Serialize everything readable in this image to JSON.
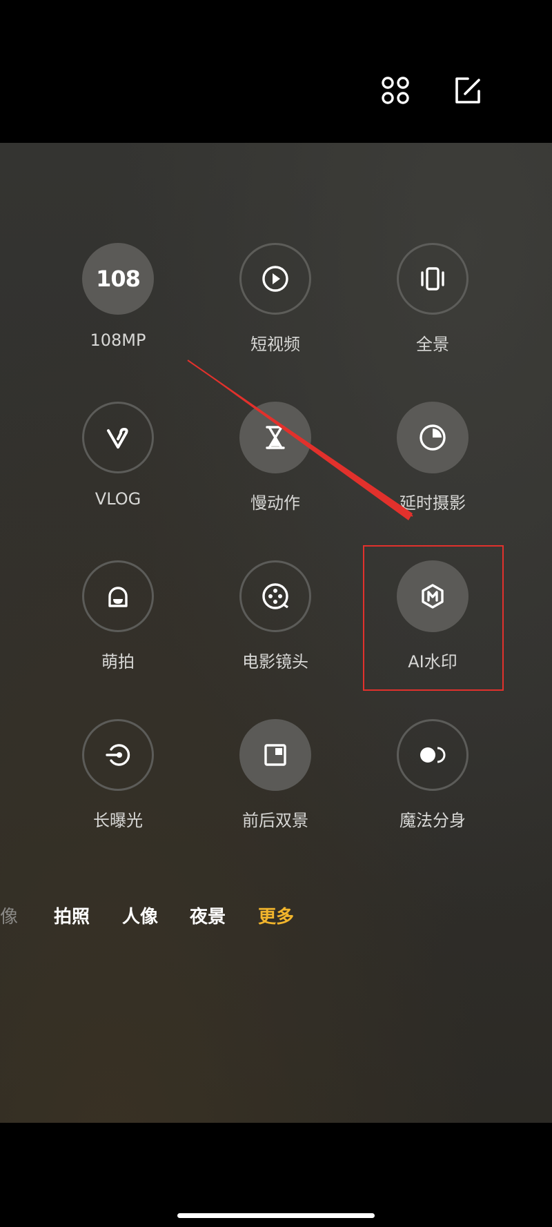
{
  "top_bar": {
    "grid_icon": "grid-dots-icon",
    "edit_icon": "edit-icon"
  },
  "modes": [
    {
      "id": "108mp",
      "label": "108MP",
      "icon": "108",
      "filled": true
    },
    {
      "id": "short-video",
      "label": "短视频",
      "icon": "play-circle-icon",
      "filled": false
    },
    {
      "id": "panorama",
      "label": "全景",
      "icon": "panorama-icon",
      "filled": false
    },
    {
      "id": "vlog",
      "label": "VLOG",
      "icon": "vlog-icon",
      "filled": false
    },
    {
      "id": "slow-motion",
      "label": "慢动作",
      "icon": "hourglass-icon",
      "filled": true
    },
    {
      "id": "timelapse",
      "label": "延时摄影",
      "icon": "timelapse-icon",
      "filled": true
    },
    {
      "id": "cute-shot",
      "label": "萌拍",
      "icon": "cute-face-icon",
      "filled": false
    },
    {
      "id": "movie-lens",
      "label": "电影镜头",
      "icon": "film-reel-icon",
      "filled": false
    },
    {
      "id": "ai-watermark",
      "label": "AI水印",
      "icon": "watermark-hexagon-icon",
      "filled": true
    },
    {
      "id": "long-exposure",
      "label": "长曝光",
      "icon": "long-exposure-icon",
      "filled": false
    },
    {
      "id": "dual-view",
      "label": "前后双景",
      "icon": "dual-view-icon",
      "filled": true
    },
    {
      "id": "clone",
      "label": "魔法分身",
      "icon": "clone-icon",
      "filled": false
    }
  ],
  "tabs": {
    "portrait_partial": "像",
    "photo": "拍照",
    "portrait": "人像",
    "night": "夜景",
    "more": "更多"
  },
  "colors": {
    "accent": "#f2b52c",
    "highlight": "#e2312c"
  }
}
